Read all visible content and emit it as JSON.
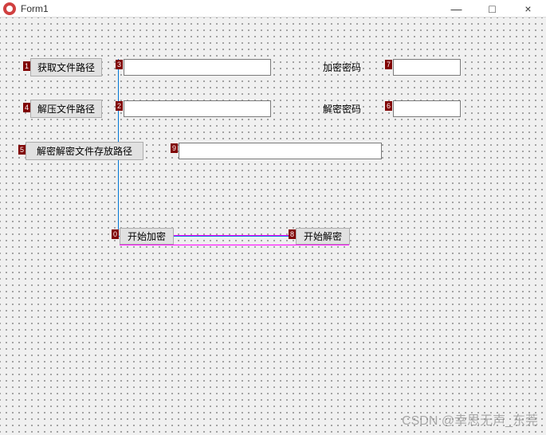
{
  "window": {
    "title": "Form1",
    "minimize": "—",
    "maximize": "□",
    "close": "×"
  },
  "buttons": {
    "get_file_path": "获取文件路径",
    "extract_file_path": "解压文件路径",
    "output_path": "解密解密文件存放路径",
    "start_encrypt": "开始加密",
    "start_decrypt": "开始解密"
  },
  "labels": {
    "encrypt_password": "加密密码",
    "decrypt_password": "解密密码"
  },
  "inputs": {
    "file_path": "",
    "extract_path": "",
    "output_path": "",
    "encrypt_password": "",
    "decrypt_password": ""
  },
  "tags": {
    "t0": "0",
    "t1": "1",
    "t3": "3",
    "t4": "4",
    "t5": "5",
    "t6": "6",
    "t7": "7",
    "t8": "8",
    "t9": "9",
    "t10": "2"
  },
  "watermark": "CSDN @幸思无声_东莞"
}
